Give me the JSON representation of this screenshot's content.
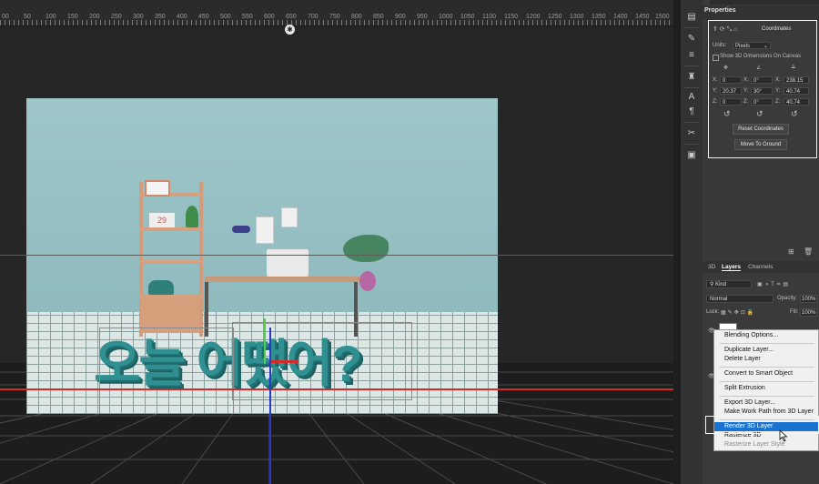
{
  "ruler": {
    "numbers": [
      "00",
      "50",
      "100",
      "150",
      "200",
      "250",
      "300",
      "350",
      "400",
      "450",
      "500",
      "550",
      "600",
      "650",
      "700",
      "750",
      "800",
      "850",
      "900",
      "950",
      "1000",
      "1050",
      "1100",
      "1150",
      "1200",
      "1250",
      "1300",
      "1350",
      "1400",
      "1450",
      "1500"
    ]
  },
  "canvas": {
    "text_3d": "오늘 어땠어?",
    "clock_digits": "29"
  },
  "properties": {
    "tab": "Properties",
    "section": "Coordinates",
    "units_label": "Units:",
    "units_value": "Pixels",
    "show_3d_dimensions": "Show 3D Dimensions On Canvas",
    "position": {
      "x_label": "X:",
      "x": "0",
      "y_label": "Y:",
      "y": "20.37",
      "z_label": "Z:",
      "z": "0"
    },
    "rotation": {
      "x_label": "X:",
      "x": "0°",
      "y_label": "Y:",
      "y": "30°",
      "z_label": "Z:",
      "z": "0°"
    },
    "scale": {
      "x_label": "X:",
      "x": "238.15",
      "y_label": "Y:",
      "y": "40.74",
      "z_label": "Z:",
      "z": "40.74"
    },
    "reset_button": "Reset Coordinates",
    "ground_button": "Move To Ground"
  },
  "layers": {
    "tabs": [
      "3D",
      "Layers",
      "Channels"
    ],
    "filter": "Kind",
    "blend_mode": "Normal",
    "opacity_label": "Opacity:",
    "opacity": "100%",
    "lock_label": "Lock:",
    "fill_label": "Fill:",
    "fill": "100%"
  },
  "context_menu": {
    "items": [
      "Blending Options...",
      "Duplicate Layer...",
      "Delete Layer",
      "Convert to Smart Object",
      "Split Extrusion",
      "Export 3D Layer...",
      "Make Work Path from 3D Layer",
      "Render 3D Layer",
      "Rasterize 3D",
      "Rasterize Layer Style"
    ],
    "highlighted": "Render 3D Layer"
  },
  "colors": {
    "accent_highlight": "#1a73d0",
    "x_axis": "#d52b2b",
    "z_axis": "#2b37c8",
    "text_3d": "#2f8f91"
  }
}
